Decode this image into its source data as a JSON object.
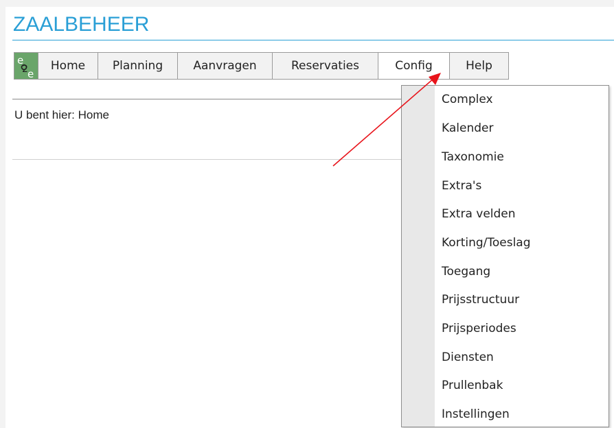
{
  "app": {
    "title": "ZAALBEHEER"
  },
  "menu": {
    "logo_icon": "e2e-logo-icon",
    "items": [
      {
        "label": "Home"
      },
      {
        "label": "Planning"
      },
      {
        "label": "Aanvragen"
      },
      {
        "label": "Reservaties"
      },
      {
        "label": "Config"
      },
      {
        "label": "Help"
      }
    ],
    "active": "Config"
  },
  "breadcrumb": {
    "text": "U bent hier: Home"
  },
  "dropdown": {
    "items": [
      {
        "label": "Complex"
      },
      {
        "label": "Kalender"
      },
      {
        "label": "Taxonomie"
      },
      {
        "label": "Extra's"
      },
      {
        "label": "Extra velden"
      },
      {
        "label": "Korting/Toeslag"
      },
      {
        "label": "Toegang"
      },
      {
        "label": "Prijsstructuur"
      },
      {
        "label": "Prijsperiodes"
      },
      {
        "label": "Diensten"
      },
      {
        "label": "Prullenbak"
      },
      {
        "label": "Instellingen"
      }
    ]
  },
  "annotation": {
    "icon": "red-arrow-icon",
    "color": "#e8141b"
  },
  "colors": {
    "brand": "#2a9fd6",
    "logo": "#6aa56a"
  }
}
